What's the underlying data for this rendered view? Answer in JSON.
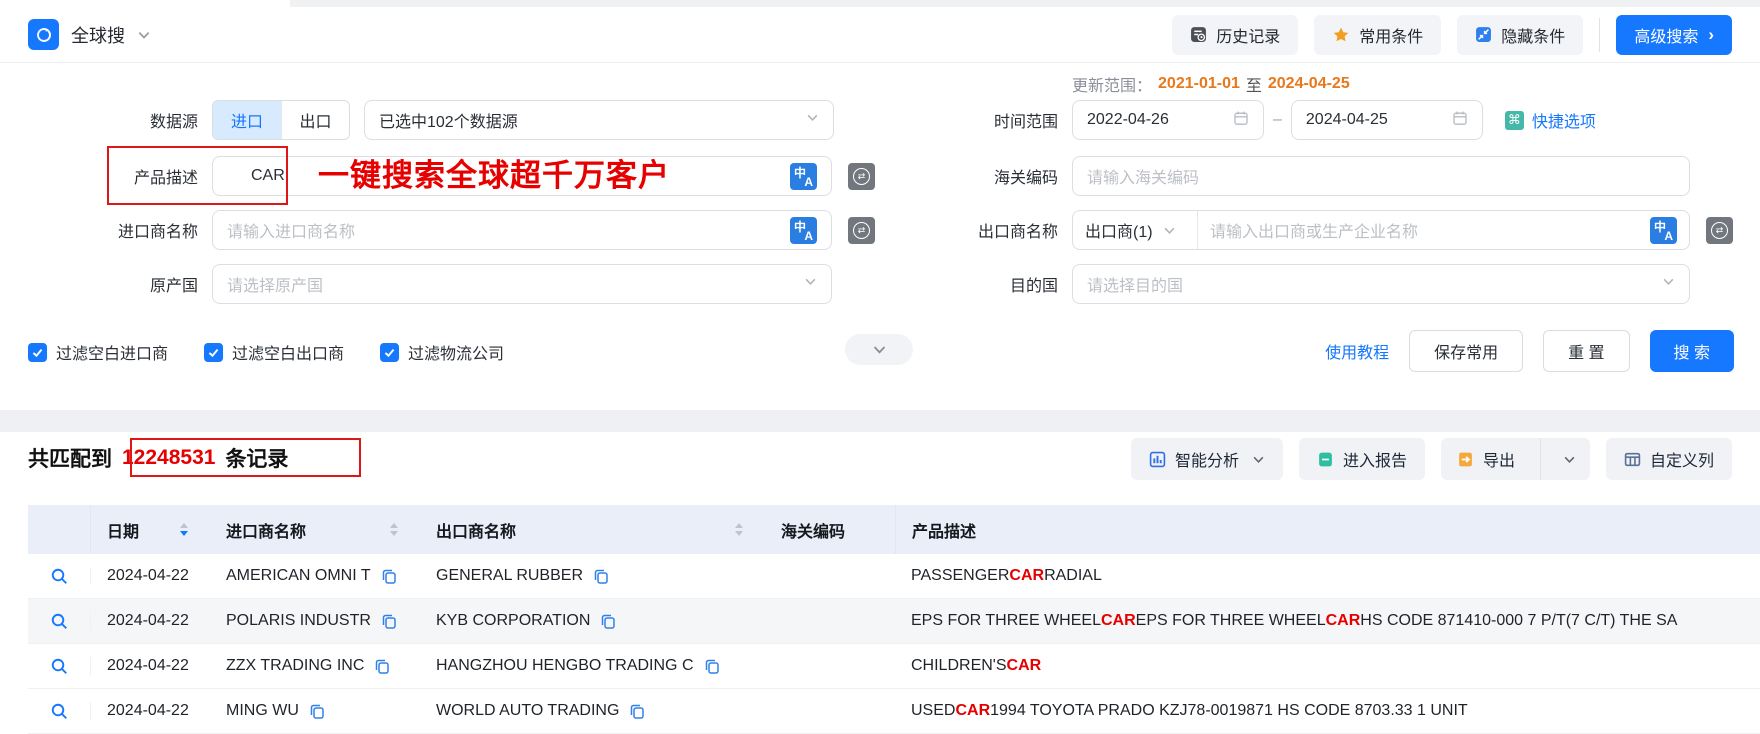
{
  "topbar": {
    "app_title": "全球搜",
    "history": "历史记录",
    "favorites": "常用条件",
    "hide": "隐藏条件",
    "advanced": "高级搜索",
    "advanced_arrow": "›"
  },
  "form": {
    "data_source_label": "数据源",
    "import_tab": "进口",
    "export_tab": "出口",
    "datasource_selected": "已选中102个数据源",
    "product_label": "产品描述",
    "product_value": "CAR",
    "annotation_text": "一键搜索全球超千万客户",
    "importer_label": "进口商名称",
    "importer_placeholder": "请输入进口商名称",
    "origin_label": "原产国",
    "origin_placeholder": "请选择原产国",
    "update_label": "更新范围：",
    "update_start": "2021-01-01",
    "update_to": "至",
    "update_end": "2024-04-25",
    "time_label": "时间范围",
    "time_start": "2022-04-26",
    "time_dash": "–",
    "time_end": "2024-04-25",
    "quick_option": "快捷选项",
    "quick_icon_glyph": "⌘",
    "hs_label": "海关编码",
    "hs_placeholder": "请输入海关编码",
    "exporter_label": "出口商名称",
    "exporter_type": "出口商(1)",
    "exporter_placeholder": "请输入出口商或生产企业名称",
    "dest_label": "目的国",
    "dest_placeholder": "请选择目的国",
    "translate_icon_zh": "中",
    "translate_icon_en": "A",
    "synonym_icon_glyph": "⇄",
    "filters": [
      {
        "label": "过滤空白进口商",
        "checked": true
      },
      {
        "label": "过滤空白出口商",
        "checked": true
      },
      {
        "label": "过滤物流公司",
        "checked": true
      }
    ],
    "tutorial": "使用教程",
    "save_btn": "保存常用",
    "reset_btn": "重 置",
    "search_btn": "搜 索"
  },
  "results": {
    "prefix": "共匹配到",
    "count": "12248531",
    "suffix": "条记录",
    "analysis": "智能分析",
    "report": "进入报告",
    "export": "导出",
    "custom_columns": "自定义列"
  },
  "table": {
    "headers": [
      {
        "label": "",
        "sort": null
      },
      {
        "label": "日期",
        "sort": "desc"
      },
      {
        "label": "进口商名称",
        "sort": "none"
      },
      {
        "label": "出口商名称",
        "sort": "none"
      },
      {
        "label": "海关编码",
        "sort": null
      },
      {
        "label": "产品描述",
        "sort": null
      }
    ],
    "rows": [
      {
        "date": "2024-04-22",
        "importer": "AMERICAN OMNI T",
        "exporter": "GENERAL RUBBER",
        "hs": "",
        "desc": [
          [
            "PASSENGER ",
            0
          ],
          [
            "CAR",
            1
          ],
          [
            " RADIAL",
            0
          ]
        ]
      },
      {
        "date": "2024-04-22",
        "importer": "POLARIS INDUSTR",
        "exporter": "KYB CORPORATION",
        "hs": "",
        "desc": [
          [
            "EPS FOR THREE WHEEL ",
            0
          ],
          [
            "CAR",
            1
          ],
          [
            " EPS FOR THREE WHEEL ",
            0
          ],
          [
            "CAR",
            1
          ],
          [
            " HS CODE 871410-000 7 P/T(7 C/T) THE SA",
            0
          ]
        ]
      },
      {
        "date": "2024-04-22",
        "importer": "ZZX TRADING INC",
        "exporter": "HANGZHOU HENGBO TRADING C",
        "hs": "",
        "desc": [
          [
            "CHILDREN'S ",
            0
          ],
          [
            "CAR",
            1
          ]
        ]
      },
      {
        "date": "2024-04-22",
        "importer": "MING WU",
        "exporter": "WORLD AUTO TRADING",
        "hs": "",
        "desc": [
          [
            "USED ",
            0
          ],
          [
            "CAR",
            1
          ],
          [
            " 1994 TOYOTA PRADO KZJ78-0019871 HS CODE 8703.33 1 UNIT",
            0
          ]
        ]
      }
    ]
  },
  "colors": {
    "accent": "#1677ff",
    "highlight": "#e60000",
    "date_orange": "#e8781a"
  }
}
